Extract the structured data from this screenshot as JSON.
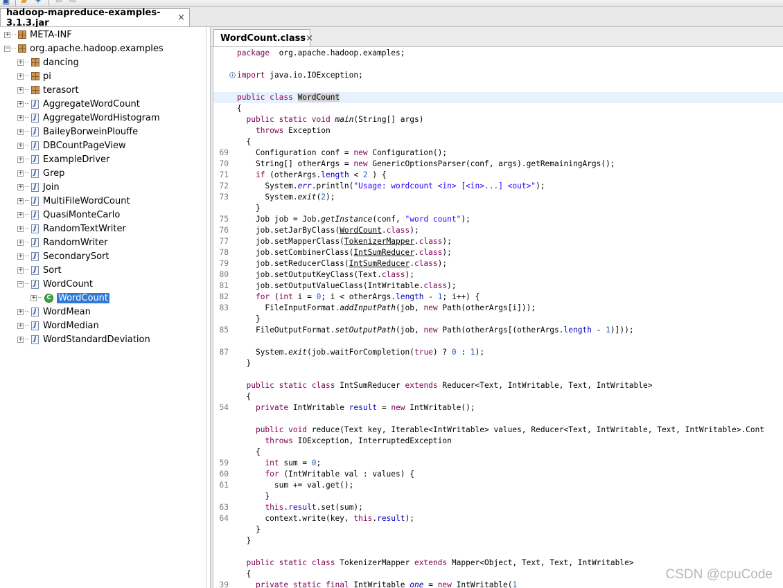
{
  "toolbar": {
    "icons": [
      "save-icon",
      "open-folder-icon",
      "find-icon",
      "back-arrow-icon",
      "forward-arrow-icon"
    ]
  },
  "outer_tab": {
    "label": "hadoop-mapreduce-examples-3.1.3.jar",
    "close": "×"
  },
  "editor_tab": {
    "label": "WordCount.class",
    "close": "×"
  },
  "tree": [
    {
      "label": "META-INF",
      "indent": 0,
      "expander": "+",
      "icon": "package"
    },
    {
      "label": "org.apache.hadoop.examples",
      "indent": 0,
      "expander": "−",
      "icon": "package"
    },
    {
      "label": "dancing",
      "indent": 1,
      "expander": "+",
      "icon": "package"
    },
    {
      "label": "pi",
      "indent": 1,
      "expander": "+",
      "icon": "package"
    },
    {
      "label": "terasort",
      "indent": 1,
      "expander": "+",
      "icon": "package"
    },
    {
      "label": "AggregateWordCount",
      "indent": 1,
      "expander": "+",
      "icon": "java"
    },
    {
      "label": "AggregateWordHistogram",
      "indent": 1,
      "expander": "+",
      "icon": "java"
    },
    {
      "label": "BaileyBorweinPlouffe",
      "indent": 1,
      "expander": "+",
      "icon": "java"
    },
    {
      "label": "DBCountPageView",
      "indent": 1,
      "expander": "+",
      "icon": "java"
    },
    {
      "label": "ExampleDriver",
      "indent": 1,
      "expander": "+",
      "icon": "java"
    },
    {
      "label": "Grep",
      "indent": 1,
      "expander": "+",
      "icon": "java"
    },
    {
      "label": "Join",
      "indent": 1,
      "expander": "+",
      "icon": "java"
    },
    {
      "label": "MultiFileWordCount",
      "indent": 1,
      "expander": "+",
      "icon": "java"
    },
    {
      "label": "QuasiMonteCarlo",
      "indent": 1,
      "expander": "+",
      "icon": "java"
    },
    {
      "label": "RandomTextWriter",
      "indent": 1,
      "expander": "+",
      "icon": "java"
    },
    {
      "label": "RandomWriter",
      "indent": 1,
      "expander": "+",
      "icon": "java"
    },
    {
      "label": "SecondarySort",
      "indent": 1,
      "expander": "+",
      "icon": "java"
    },
    {
      "label": "Sort",
      "indent": 1,
      "expander": "+",
      "icon": "java"
    },
    {
      "label": "WordCount",
      "indent": 1,
      "expander": "−",
      "icon": "java"
    },
    {
      "label": "WordCount",
      "indent": 2,
      "expander": "+",
      "icon": "class",
      "selected": true
    },
    {
      "label": "WordMean",
      "indent": 1,
      "expander": "+",
      "icon": "java"
    },
    {
      "label": "WordMedian",
      "indent": 1,
      "expander": "+",
      "icon": "java"
    },
    {
      "label": "WordStandardDeviation",
      "indent": 1,
      "expander": "+",
      "icon": "java"
    }
  ],
  "code_lines": [
    {
      "ln": "",
      "segs": [
        [
          "kw",
          "package"
        ],
        [
          "",
          "  org.apache.hadoop.examples;"
        ]
      ]
    },
    {
      "ln": "",
      "segs": []
    },
    {
      "ln": "",
      "fold": "+",
      "segs": [
        [
          "kw",
          "import"
        ],
        [
          "",
          " java.io.IOException;"
        ]
      ]
    },
    {
      "ln": "",
      "segs": []
    },
    {
      "ln": "",
      "hl": true,
      "segs": [
        [
          "kw",
          "public class "
        ],
        [
          "occ",
          "WordCount"
        ]
      ]
    },
    {
      "ln": "",
      "segs": [
        [
          "",
          "{"
        ]
      ]
    },
    {
      "ln": "",
      "segs": [
        [
          "",
          "  "
        ],
        [
          "kw",
          "public static void "
        ],
        [
          "it",
          "main"
        ],
        [
          "",
          "(String[] args)"
        ]
      ]
    },
    {
      "ln": "",
      "segs": [
        [
          "",
          "    "
        ],
        [
          "kw",
          "throws"
        ],
        [
          "",
          " Exception"
        ]
      ]
    },
    {
      "ln": "",
      "segs": [
        [
          "",
          "  {"
        ]
      ]
    },
    {
      "ln": "69",
      "segs": [
        [
          "",
          "    Configuration conf = "
        ],
        [
          "kw",
          "new"
        ],
        [
          "",
          " Configuration();"
        ]
      ]
    },
    {
      "ln": "70",
      "segs": [
        [
          "",
          "    String[] otherArgs = "
        ],
        [
          "kw",
          "new"
        ],
        [
          "",
          " GenericOptionsParser(conf, args).getRemainingArgs();"
        ]
      ]
    },
    {
      "ln": "71",
      "segs": [
        [
          "",
          "    "
        ],
        [
          "kw",
          "if"
        ],
        [
          "",
          " (otherArgs."
        ],
        [
          "fld",
          "length"
        ],
        [
          "",
          " < "
        ],
        [
          "num",
          "2"
        ],
        [
          "",
          " ) {"
        ]
      ]
    },
    {
      "ln": "72",
      "segs": [
        [
          "",
          "      System."
        ],
        [
          "fld it",
          "err"
        ],
        [
          "",
          ".println("
        ],
        [
          "str",
          "\"Usage: wordcount <in> [<in>...] <out>\""
        ],
        [
          "",
          ");"
        ]
      ]
    },
    {
      "ln": "73",
      "segs": [
        [
          "",
          "      System."
        ],
        [
          "it",
          "exit"
        ],
        [
          "",
          "("
        ],
        [
          "num",
          "2"
        ],
        [
          "",
          ");"
        ]
      ]
    },
    {
      "ln": "",
      "segs": [
        [
          "",
          "    }"
        ]
      ]
    },
    {
      "ln": "75",
      "segs": [
        [
          "",
          "    Job job = Job."
        ],
        [
          "it",
          "getInstance"
        ],
        [
          "",
          "(conf, "
        ],
        [
          "str",
          "\"word count\""
        ],
        [
          "",
          ");"
        ]
      ]
    },
    {
      "ln": "76",
      "segs": [
        [
          "",
          "    job.setJarByClass("
        ],
        [
          "ul",
          "WordCount"
        ],
        [
          "",
          "."
        ],
        [
          "kw",
          "class"
        ],
        [
          "",
          ");"
        ]
      ]
    },
    {
      "ln": "77",
      "segs": [
        [
          "",
          "    job.setMapperClass("
        ],
        [
          "ul",
          "TokenizerMapper"
        ],
        [
          "",
          "."
        ],
        [
          "kw",
          "class"
        ],
        [
          "",
          ");"
        ]
      ]
    },
    {
      "ln": "78",
      "segs": [
        [
          "",
          "    job.setCombinerClass("
        ],
        [
          "ul",
          "IntSumReducer"
        ],
        [
          "",
          "."
        ],
        [
          "kw",
          "class"
        ],
        [
          "",
          ");"
        ]
      ]
    },
    {
      "ln": "79",
      "segs": [
        [
          "",
          "    job.setReducerClass("
        ],
        [
          "ul",
          "IntSumReducer"
        ],
        [
          "",
          "."
        ],
        [
          "kw",
          "class"
        ],
        [
          "",
          ");"
        ]
      ]
    },
    {
      "ln": "80",
      "segs": [
        [
          "",
          "    job.setOutputKeyClass(Text."
        ],
        [
          "kw",
          "class"
        ],
        [
          "",
          ");"
        ]
      ]
    },
    {
      "ln": "81",
      "segs": [
        [
          "",
          "    job.setOutputValueClass(IntWritable."
        ],
        [
          "kw",
          "class"
        ],
        [
          "",
          ");"
        ]
      ]
    },
    {
      "ln": "82",
      "segs": [
        [
          "",
          "    "
        ],
        [
          "kw",
          "for"
        ],
        [
          "",
          " ("
        ],
        [
          "kw",
          "int"
        ],
        [
          "",
          " i = "
        ],
        [
          "num",
          "0"
        ],
        [
          "",
          "; i < otherArgs."
        ],
        [
          "fld",
          "length"
        ],
        [
          "",
          " - "
        ],
        [
          "num",
          "1"
        ],
        [
          "",
          "; i++) {"
        ]
      ]
    },
    {
      "ln": "83",
      "segs": [
        [
          "",
          "      FileInputFormat."
        ],
        [
          "it",
          "addInputPath"
        ],
        [
          "",
          "(job, "
        ],
        [
          "kw",
          "new"
        ],
        [
          "",
          " Path(otherArgs[i]));"
        ]
      ]
    },
    {
      "ln": "",
      "segs": [
        [
          "",
          "    }"
        ]
      ]
    },
    {
      "ln": "85",
      "segs": [
        [
          "",
          "    FileOutputFormat."
        ],
        [
          "it",
          "setOutputPath"
        ],
        [
          "",
          "(job, "
        ],
        [
          "kw",
          "new"
        ],
        [
          "",
          " Path(otherArgs[(otherArgs."
        ],
        [
          "fld",
          "length"
        ],
        [
          "",
          " - "
        ],
        [
          "num",
          "1"
        ],
        [
          "",
          ")]));"
        ]
      ]
    },
    {
      "ln": "",
      "segs": []
    },
    {
      "ln": "87",
      "segs": [
        [
          "",
          "    System."
        ],
        [
          "it",
          "exit"
        ],
        [
          "",
          "(job.waitForCompletion("
        ],
        [
          "kw",
          "true"
        ],
        [
          "",
          ") ? "
        ],
        [
          "num",
          "0"
        ],
        [
          "",
          " : "
        ],
        [
          "num",
          "1"
        ],
        [
          "",
          ");"
        ]
      ]
    },
    {
      "ln": "",
      "segs": [
        [
          "",
          "  }"
        ]
      ]
    },
    {
      "ln": "",
      "segs": []
    },
    {
      "ln": "",
      "segs": [
        [
          "",
          "  "
        ],
        [
          "kw",
          "public static class "
        ],
        [
          "",
          "IntSumReducer "
        ],
        [
          "kw",
          "extends"
        ],
        [
          "",
          " Reducer<Text, IntWritable, Text, IntWritable>"
        ]
      ]
    },
    {
      "ln": "",
      "segs": [
        [
          "",
          "  {"
        ]
      ]
    },
    {
      "ln": "54",
      "segs": [
        [
          "",
          "    "
        ],
        [
          "kw",
          "private"
        ],
        [
          "",
          " IntWritable "
        ],
        [
          "fld",
          "result"
        ],
        [
          "",
          " = "
        ],
        [
          "kw",
          "new"
        ],
        [
          "",
          " IntWritable();"
        ]
      ]
    },
    {
      "ln": "",
      "segs": []
    },
    {
      "ln": "",
      "segs": [
        [
          "",
          "    "
        ],
        [
          "kw",
          "public void "
        ],
        [
          "",
          "reduce(Text key, Iterable<IntWritable> values, Reducer<Text, IntWritable, Text, IntWritable>.Cont"
        ]
      ]
    },
    {
      "ln": "",
      "segs": [
        [
          "",
          "      "
        ],
        [
          "kw",
          "throws"
        ],
        [
          "",
          " IOException, InterruptedException"
        ]
      ]
    },
    {
      "ln": "",
      "segs": [
        [
          "",
          "    {"
        ]
      ]
    },
    {
      "ln": "59",
      "segs": [
        [
          "",
          "      "
        ],
        [
          "kw",
          "int"
        ],
        [
          "",
          " sum = "
        ],
        [
          "num",
          "0"
        ],
        [
          "",
          ";"
        ]
      ]
    },
    {
      "ln": "60",
      "segs": [
        [
          "",
          "      "
        ],
        [
          "kw",
          "for"
        ],
        [
          "",
          " (IntWritable val : values) {"
        ]
      ]
    },
    {
      "ln": "61",
      "segs": [
        [
          "",
          "        sum += val.get();"
        ]
      ]
    },
    {
      "ln": "",
      "segs": [
        [
          "",
          "      }"
        ]
      ]
    },
    {
      "ln": "63",
      "segs": [
        [
          "",
          "      "
        ],
        [
          "kw",
          "this"
        ],
        [
          "",
          "."
        ],
        [
          "fld",
          "result"
        ],
        [
          "",
          ".set(sum);"
        ]
      ]
    },
    {
      "ln": "64",
      "segs": [
        [
          "",
          "      context.write(key, "
        ],
        [
          "kw",
          "this"
        ],
        [
          "",
          "."
        ],
        [
          "fld",
          "result"
        ],
        [
          "",
          ");"
        ]
      ]
    },
    {
      "ln": "",
      "segs": [
        [
          "",
          "    }"
        ]
      ]
    },
    {
      "ln": "",
      "segs": [
        [
          "",
          "  }"
        ]
      ]
    },
    {
      "ln": "",
      "segs": []
    },
    {
      "ln": "",
      "segs": [
        [
          "",
          "  "
        ],
        [
          "kw",
          "public static class "
        ],
        [
          "",
          "TokenizerMapper "
        ],
        [
          "kw",
          "extends"
        ],
        [
          "",
          " Mapper<Object, Text, Text, IntWritable>"
        ]
      ]
    },
    {
      "ln": "",
      "segs": [
        [
          "",
          "  {"
        ]
      ]
    },
    {
      "ln": "39",
      "segs": [
        [
          "",
          "    "
        ],
        [
          "kw",
          "private static final"
        ],
        [
          "",
          " IntWritable "
        ],
        [
          "fld it",
          "one"
        ],
        [
          "",
          " = "
        ],
        [
          "kw",
          "new"
        ],
        [
          "",
          " IntWritable("
        ],
        [
          "num",
          "1"
        ],
        [
          ");"
        ]
      ]
    }
  ],
  "watermark": "CSDN @cpuCode"
}
